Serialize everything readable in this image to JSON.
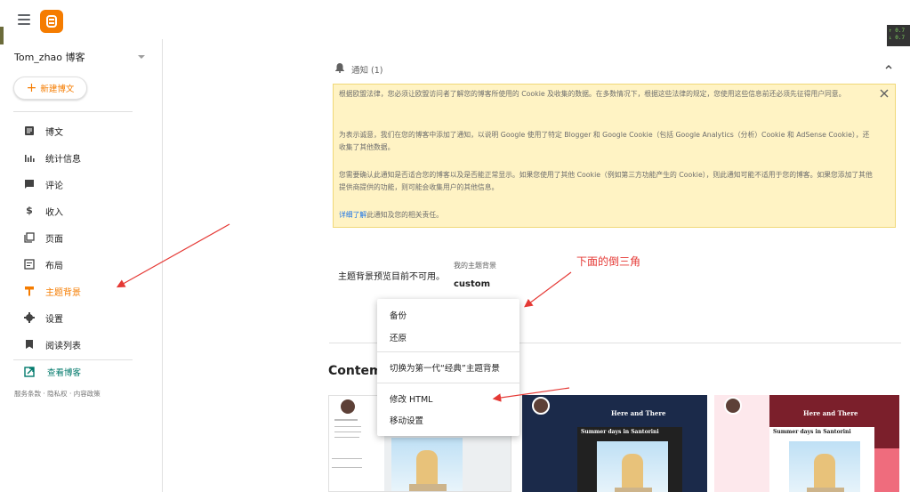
{
  "sidebar": {
    "blog_name": "Tom_zhao 博客",
    "new_post_label": "新建博文",
    "items": [
      {
        "label": "博文"
      },
      {
        "label": "统计信息"
      },
      {
        "label": "评论"
      },
      {
        "label": "收入"
      },
      {
        "label": "页面"
      },
      {
        "label": "布局"
      },
      {
        "label": "主题背景"
      },
      {
        "label": "设置"
      },
      {
        "label": "阅读列表"
      }
    ],
    "view_blog_label": "查看博客",
    "footer": "服务条款 · 隐私权 · 内容政策"
  },
  "notice": {
    "title": "通知 (1)",
    "para1": "根据欧盟法律，您必须让欧盟访问者了解您的博客所使用的 Cookie 及收集的数据。在多数情况下，根据这些法律的规定，您使用这些信息前还必须先征得用户同意。",
    "para2": "为表示诚意，我们在您的博客中添加了通知，以说明 Google 使用了特定 Blogger 和 Google Cookie（包括 Google Analytics（分析）Cookie 和 AdSense Cookie），还收集了其他数据。",
    "para3": "您需要确认此通知是否适合您的博客以及是否能正常显示。如果您使用了其他 Cookie（例如第三方功能产生的 Cookie），则此通知可能不适用于您的博客。如果您添加了其他提供商提供的功能，则可能会收集用户的其他信息。",
    "link_text": "详细了解",
    "link_suffix": "此通知及您的相关责任。"
  },
  "theme": {
    "preview_unavailable": "主题背景预览目前不可用。",
    "my_theme_label": "我的主题背景",
    "my_theme_name": "custom",
    "annotation": "下面的倒三角"
  },
  "menu": {
    "items": [
      "备份",
      "还原",
      "切换为第一代“经典”主题背景",
      "修改 HTML",
      "移动设置"
    ]
  },
  "gallery": {
    "section_title": "Contemp",
    "cards": [
      {
        "hero": "",
        "post_title": ""
      },
      {
        "hero": "Here and There",
        "post_title": "Summer days in Santorini"
      },
      {
        "hero": "Here and There",
        "post_title": "Summer days in Santorini"
      }
    ]
  },
  "perf": {
    "up": "↑ 0.7",
    "down": "↓ 0.7"
  },
  "colors": {
    "accent": "#f57c00",
    "notice_bg": "#fff3c4",
    "teal": "#00796b",
    "annotation": "#e53935"
  }
}
